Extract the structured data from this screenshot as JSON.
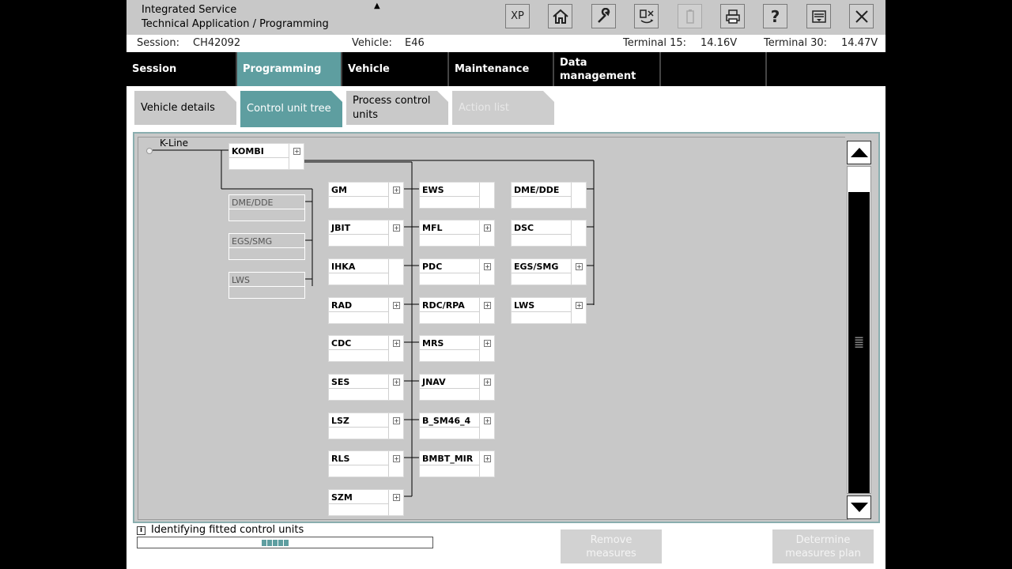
{
  "app": {
    "title_line1": "Integrated Service",
    "title_line2": "Technical Application / Programming",
    "mode_arrow": "▲"
  },
  "toolbar": {
    "buttons": [
      {
        "name": "xp-button",
        "label": "XP",
        "icon": "xp-icon",
        "enabled": true
      },
      {
        "name": "home-button",
        "label": "⌂",
        "icon": "home-icon",
        "enabled": true
      },
      {
        "name": "wrench-button",
        "label": "🔧",
        "icon": "wrench-icon",
        "enabled": true
      },
      {
        "name": "data-transfer-button",
        "label": "⇄",
        "icon": "transfer-icon",
        "enabled": true
      },
      {
        "name": "battery-button",
        "label": "▯",
        "icon": "battery-icon",
        "enabled": false
      },
      {
        "name": "print-button",
        "label": "⎙",
        "icon": "printer-icon",
        "enabled": true
      },
      {
        "name": "help-button",
        "label": "?",
        "icon": "help-icon",
        "enabled": true
      },
      {
        "name": "screen-menu-button",
        "label": "▤",
        "icon": "menu-icon",
        "enabled": true
      },
      {
        "name": "close-button",
        "label": "✕",
        "icon": "close-icon",
        "enabled": true
      }
    ]
  },
  "session_bar": {
    "session_label": "Session:",
    "session_value": "CH42092",
    "vehicle_label": "Vehicle:",
    "vehicle_value": "E46",
    "t15_label": "Terminal 15:",
    "t15_value": "14.16V",
    "t30_label": "Terminal 30:",
    "t30_value": "14.47V"
  },
  "main_tabs": [
    {
      "label": "Session"
    },
    {
      "label": "Programming"
    },
    {
      "label": "Vehicle"
    },
    {
      "label": "Maintenance"
    },
    {
      "label_line1": "Data",
      "label_line2": "management"
    },
    {
      "label": ""
    },
    {
      "label": ""
    }
  ],
  "sub_tabs": [
    {
      "label": "Vehicle details"
    },
    {
      "label": "Control unit tree"
    },
    {
      "label_line1": "Process control",
      "label_line2": "units"
    },
    {
      "label": "Action list"
    }
  ],
  "tree": {
    "bus_label": "K-Line",
    "root": "KOMBI",
    "left_column": [
      "DME/DDE",
      "EGS/SMG",
      "LWS"
    ],
    "column_a": [
      "GM",
      "JBIT",
      "IHKA",
      "RAD",
      "CDC",
      "SES",
      "LSZ",
      "RLS",
      "SZM"
    ],
    "column_b": [
      "EWS",
      "MFL",
      "PDC",
      "RDC/RPA",
      "MRS",
      "JNAV",
      "B_SM46_4",
      "BMBT_MIR"
    ],
    "column_c": [
      "DME/DDE",
      "DSC",
      "EGS/SMG",
      "LWS"
    ],
    "expand_glyph": "+"
  },
  "scroll": {
    "grip": "≡"
  },
  "status": {
    "icon": "i",
    "text": "Identifying fitted control units",
    "progress_percent": 42
  },
  "actions": {
    "remove_line1": "Remove",
    "remove_line2": "measures",
    "determine_line1": "Determine",
    "determine_line2": "measures plan"
  },
  "colors": {
    "accent": "#5e9ea0",
    "panel": "#c8c8c8",
    "titlebar": "#c8c8c8"
  }
}
